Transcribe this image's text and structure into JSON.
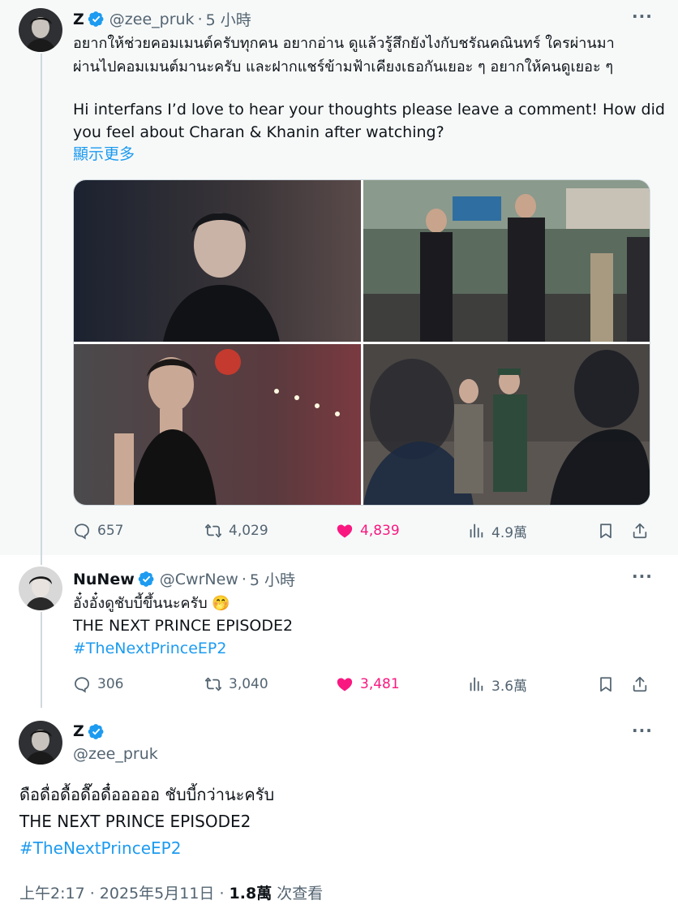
{
  "tweet1": {
    "display_name": "Z",
    "handle": "@zee_pruk",
    "separator": "·",
    "time": "5 小時",
    "more": "···",
    "thai_line1": "อยากให้ช่วยคอมเมนต์ครับทุกคน อยากอ่าน ดูแล้วรู้สึกยังไงกับชรัณคณินทร์ ใครผ่านมา",
    "thai_line2": "ผ่านไปคอมเมนต์มานะครับ และฝากแชร์ข้ามฟ้าเคียงเธอกันเยอะ ๆ อยากให้คนดูเยอะ ๆ",
    "en_line1": "Hi interfans I’d love to hear your thoughts please leave a comment! How did",
    "en_line2": "you feel about Charan & Khanin after watching?",
    "show_more": "顯示更多",
    "replies": "657",
    "reposts": "4,029",
    "likes": "4,839",
    "views": "4.9萬"
  },
  "tweet2": {
    "display_name": "NuNew",
    "handle": "@CwrNew",
    "separator": "·",
    "time": "5 小時",
    "more": "···",
    "line1": "อั๋งอั๋งดูชับบี้ขึ้นนะครับ 🤭",
    "line2": "THE NEXT PRINCE EPISODE2",
    "hashtag": "#TheNextPrinceEP2",
    "replies": "306",
    "reposts": "3,040",
    "likes": "3,481",
    "views": "3.6萬"
  },
  "tweet3": {
    "display_name": "Z",
    "handle": "@zee_pruk",
    "more": "···",
    "line1": "ดือดื่อดื้อดื๊อดื๋อออออ ชับบี้กว่านะครับ",
    "line2": "THE NEXT PRINCE EPISODE2",
    "hashtag": "#TheNextPrinceEP2",
    "timestamp": "上午2:17 · 2025年5月11日 · ",
    "views_count": "1.8萬",
    "views_label": " 次查看"
  },
  "icons": {
    "reply": "reply-icon",
    "repost": "repost-icon",
    "like": "heart-icon",
    "views": "bar-chart-icon",
    "bookmark": "bookmark-icon",
    "share": "share-icon",
    "verified": "verified-badge-icon"
  },
  "colors": {
    "accent": "#1d9bf0",
    "like": "#f91880",
    "muted": "#536471",
    "text": "#0f1419",
    "highlight_bg": "#f7f9f9"
  }
}
